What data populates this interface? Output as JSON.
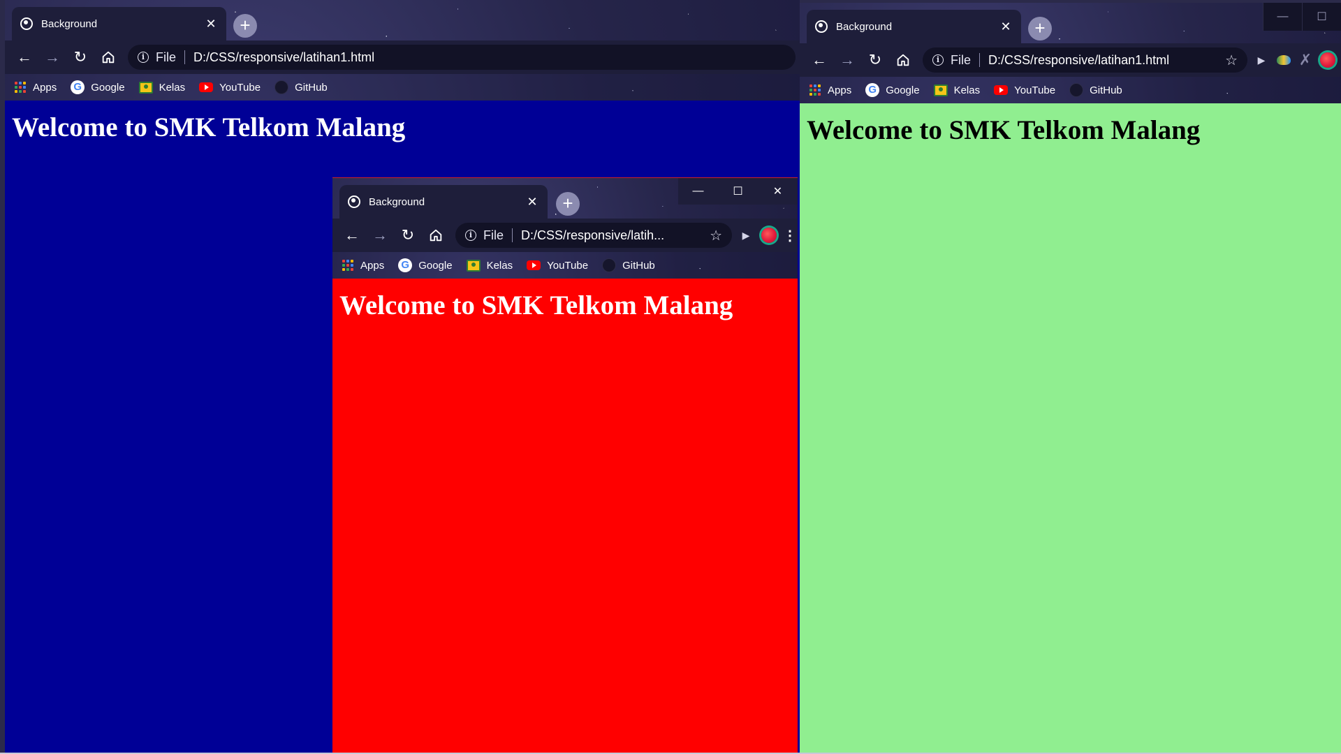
{
  "windows": {
    "blue": {
      "tab_title": "Background",
      "url_scheme": "File",
      "url": "D:/CSS/responsive/latihan1.html",
      "heading": "Welcome to SMK Telkom Malang",
      "page_bg": "#000096",
      "heading_color": "#ffffff"
    },
    "green": {
      "tab_title": "Background",
      "url_scheme": "File",
      "url": "D:/CSS/responsive/latihan1.html",
      "heading": "Welcome to SMK Telkom Malang",
      "page_bg": "#90ee90",
      "heading_color": "#000000"
    },
    "red": {
      "tab_title": "Background",
      "url_scheme": "File",
      "url": "D:/CSS/responsive/latih...",
      "heading": "Welcome to SMK Telkom Malang",
      "page_bg": "#ff0000",
      "heading_color": "#ffffff"
    }
  },
  "bookmarks": [
    "Apps",
    "Google",
    "Kelas",
    "YouTube",
    "GitHub"
  ],
  "icons": {
    "back": "arrow-left-icon",
    "forward": "arrow-right-icon",
    "reload": "reload-icon",
    "home": "home-icon",
    "star": "star-icon",
    "close": "close-icon"
  }
}
